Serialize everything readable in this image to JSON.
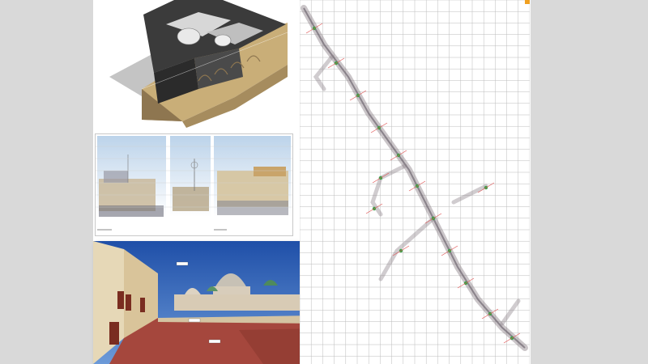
{
  "sheet": {
    "background": "#d9d9d9",
    "paper": "#ffffff"
  },
  "panels": {
    "model": {
      "kind": "3d cutaway model",
      "colors": {
        "wall": "#3a3a3a",
        "section": "#c8ad7a",
        "shadow": "#bdbdbd"
      }
    },
    "sections": {
      "kind": "point cloud elevation sections",
      "strip_count": 3
    },
    "photo": {
      "kind": "panoramic photo of rooftop terrace with domes",
      "sky": "#2d5fb8",
      "floor": "#a0443a"
    },
    "survey": {
      "kind": "laser scan traverse plan on grid",
      "grid_color": "#bcbcbc",
      "path_color": "#8a7f86",
      "marker_color": "#3aa34a",
      "axis_color": "#e05050"
    }
  }
}
